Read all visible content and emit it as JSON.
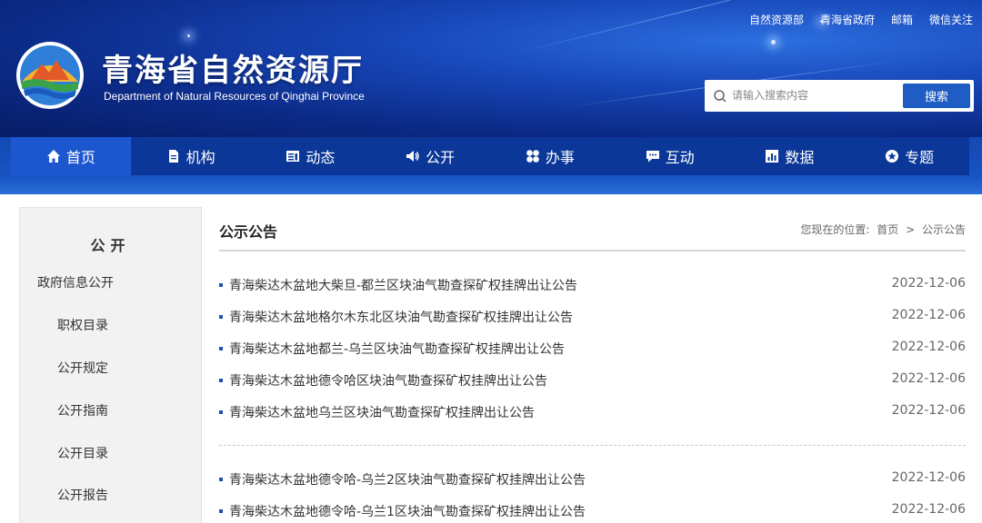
{
  "header": {
    "top_links": [
      "自然资源部",
      "青海省政府",
      "邮箱",
      "微信关注"
    ],
    "title_cn": "青海省自然资源厅",
    "title_en": "Department  of Natural Resources of Qinghai Province",
    "search": {
      "placeholder": "请输入搜索内容",
      "button_label": "搜索"
    }
  },
  "nav": {
    "items": [
      {
        "label": "首页",
        "icon": "home-icon"
      },
      {
        "label": "机构",
        "icon": "document-icon"
      },
      {
        "label": "动态",
        "icon": "news-icon"
      },
      {
        "label": "公开",
        "icon": "speaker-icon"
      },
      {
        "label": "办事",
        "icon": "grid-icon"
      },
      {
        "label": "互动",
        "icon": "chat-icon"
      },
      {
        "label": "数据",
        "icon": "chart-icon"
      },
      {
        "label": "专题",
        "icon": "badge-icon"
      }
    ],
    "active_index": 0
  },
  "sidebar": {
    "heading": "公开",
    "subheading": "政府信息公开",
    "links": [
      "职权目录",
      "公开规定",
      "公开指南",
      "公开目录",
      "公开报告"
    ]
  },
  "main": {
    "title": "公示公告",
    "breadcrumb": {
      "prefix": "您现在的位置:",
      "home": "首页",
      "sep": ">",
      "current": "公示公告"
    },
    "news": [
      {
        "title": "青海柴达木盆地大柴旦-都兰区块油气勘查探矿权挂牌出让公告",
        "date": "2022-12-06"
      },
      {
        "title": "青海柴达木盆地格尔木东北区块油气勘查探矿权挂牌出让公告",
        "date": "2022-12-06"
      },
      {
        "title": "青海柴达木盆地都兰-乌兰区块油气勘查探矿权挂牌出让公告",
        "date": "2022-12-06"
      },
      {
        "title": "青海柴达木盆地德令哈区块油气勘查探矿权挂牌出让公告",
        "date": "2022-12-06"
      },
      {
        "title": "青海柴达木盆地乌兰区块油气勘查探矿权挂牌出让公告",
        "date": "2022-12-06"
      },
      {
        "title": "青海柴达木盆地德令哈-乌兰2区块油气勘查探矿权挂牌出让公告",
        "date": "2022-12-06"
      },
      {
        "title": "青海柴达木盆地德令哈-乌兰1区块油气勘查探矿权挂牌出让公告",
        "date": "2022-12-06"
      }
    ]
  },
  "colors": {
    "nav_bg": "#0b3798",
    "nav_active": "#1d57d0",
    "accent": "#1f5cc4"
  }
}
